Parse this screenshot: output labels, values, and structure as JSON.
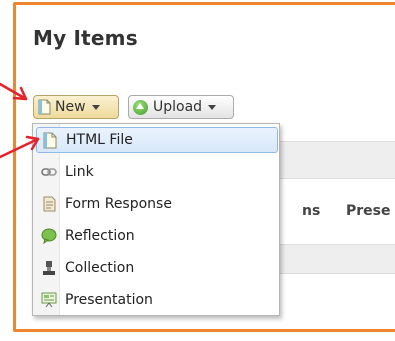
{
  "page": {
    "title": "My Items"
  },
  "toolbar": {
    "new_label": "New",
    "upload_label": "Upload"
  },
  "table": {
    "headers_partial": [
      "ns",
      "Prese"
    ]
  },
  "menu": {
    "items": [
      {
        "label": "HTML File",
        "icon": "html-file-icon",
        "highlighted": true
      },
      {
        "label": "Link",
        "icon": "link-icon"
      },
      {
        "label": "Form Response",
        "icon": "form-response-icon"
      },
      {
        "label": "Reflection",
        "icon": "reflection-icon"
      },
      {
        "label": "Collection",
        "icon": "collection-icon"
      },
      {
        "label": "Presentation",
        "icon": "presentation-icon"
      }
    ]
  },
  "colors": {
    "frame": "#f0852f",
    "annotation_arrow": "#e8202a",
    "highlight": "#d7e8fb"
  }
}
